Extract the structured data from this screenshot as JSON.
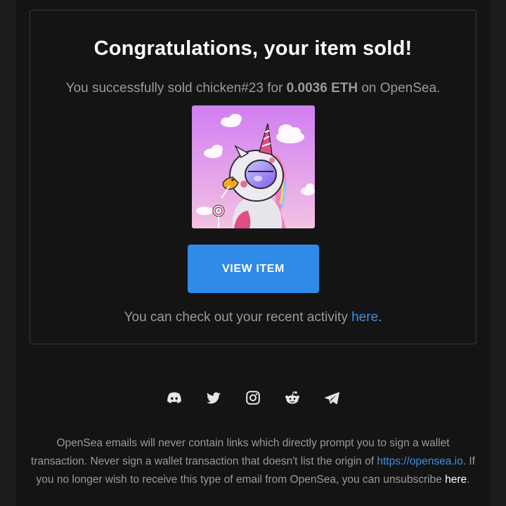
{
  "card": {
    "title": "Congratulations, your item sold!",
    "sold_prefix": "You successfully sold chicken#23 for ",
    "price": "0.0036 ETH",
    "sold_suffix": " on OpenSea.",
    "image_alt": "chicken#23",
    "button_label": "VIEW ITEM",
    "activity_prefix": "You can check out your recent activity ",
    "activity_link": "here",
    "activity_suffix": "."
  },
  "socials": [
    {
      "icon": "discord-icon"
    },
    {
      "icon": "twitter-icon"
    },
    {
      "icon": "instagram-icon"
    },
    {
      "icon": "reddit-icon"
    },
    {
      "icon": "telegram-icon"
    }
  ],
  "footer": {
    "text_1": "OpenSea emails will never contain links which directly prompt you to sign a wallet transaction. Never sign a wallet transaction that doesn't list the origin of ",
    "origin_link": "https://opensea.io",
    "text_2": ". If you no longer wish to receive this type of email from OpenSea, you can unsubscribe ",
    "unsubscribe_link": "here",
    "text_3": "."
  },
  "colors": {
    "background": "#1c1c1c",
    "email_background": "#141414",
    "button": "#2f8ae8",
    "link": "#3d8fe3"
  }
}
